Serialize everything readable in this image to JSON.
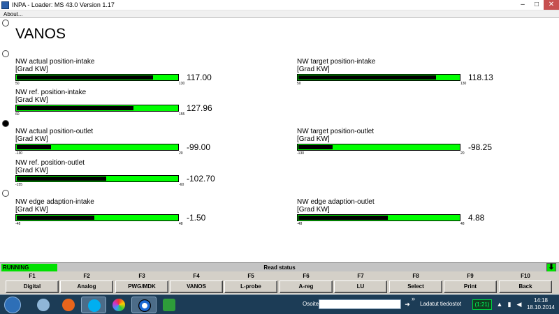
{
  "window": {
    "title": "INPA - Loader:  MS 43.0 Version 1.17",
    "controls": {
      "minimize": "–",
      "maximize": "□",
      "close": "✕"
    }
  },
  "menu": {
    "about": "About..."
  },
  "screen": {
    "title": "VANOS"
  },
  "gauges": [
    {
      "label": "NW actual position-intake",
      "unit": "[Grad KW]",
      "min": "50",
      "max": "130",
      "value": "117.00",
      "fill_fraction": 0.84
    },
    {
      "label": "NW target position-intake",
      "unit": "[Grad KW]",
      "min": "50",
      "max": "130",
      "value": "118.13",
      "fill_fraction": 0.85
    },
    {
      "label": "NW ref. position-intake",
      "unit": "[Grad KW]",
      "min": "60",
      "max": "155",
      "value": "127.96",
      "fill_fraction": 0.72
    },
    {
      "label": "NW actual position-outlet",
      "unit": "[Grad KW]",
      "min": "-130",
      "max": "20",
      "value": "-99.00",
      "fill_fraction": 0.21
    },
    {
      "label": "NW target position-outlet",
      "unit": "[Grad KW]",
      "min": "-130",
      "max": "20",
      "value": "-98.25",
      "fill_fraction": 0.21
    },
    {
      "label": "NW ref. position-outlet",
      "unit": "[Grad KW]",
      "min": "-155",
      "max": "-60",
      "value": "-102.70",
      "fill_fraction": 0.55
    },
    {
      "label": "NW edge adaption-intake",
      "unit": "[Grad KW]",
      "min": "-48",
      "max": "48",
      "value": "-1.50",
      "fill_fraction": 0.48
    },
    {
      "label": "NW edge adaption-outlet",
      "unit": "[Grad KW]",
      "min": "-48",
      "max": "48",
      "value": "4.88",
      "fill_fraction": 0.55
    }
  ],
  "status": {
    "state": "RUNNING",
    "message": "Read status",
    "arrow": "⬇"
  },
  "function_keys": [
    {
      "key": "F1",
      "label": "Digital"
    },
    {
      "key": "F2",
      "label": "Analog"
    },
    {
      "key": "F3",
      "label": "PWG/MDK"
    },
    {
      "key": "F4",
      "label": "VANOS"
    },
    {
      "key": "F5",
      "label": "L-probe"
    },
    {
      "key": "F6",
      "label": "A-reg"
    },
    {
      "key": "F7",
      "label": "LU"
    },
    {
      "key": "F8",
      "label": "Select"
    },
    {
      "key": "F9",
      "label": "Print"
    },
    {
      "key": "F10",
      "label": "Back"
    }
  ],
  "taskbar": {
    "address_label": "Osoite",
    "address_value": "",
    "downloads_label": "Ladatut tiedostot",
    "chevron": "»",
    "battery": "(1:21)",
    "time": "14:18",
    "date": "18.10.2014",
    "colors": {
      "taskbar": "#1c3c56",
      "battery_green": "#00ff60"
    }
  },
  "colors": {
    "gauge_bg": "#00ff00",
    "gauge_fill": "#000000",
    "status_running": "#00e000",
    "fkey_bg": "#d4d0c8"
  }
}
